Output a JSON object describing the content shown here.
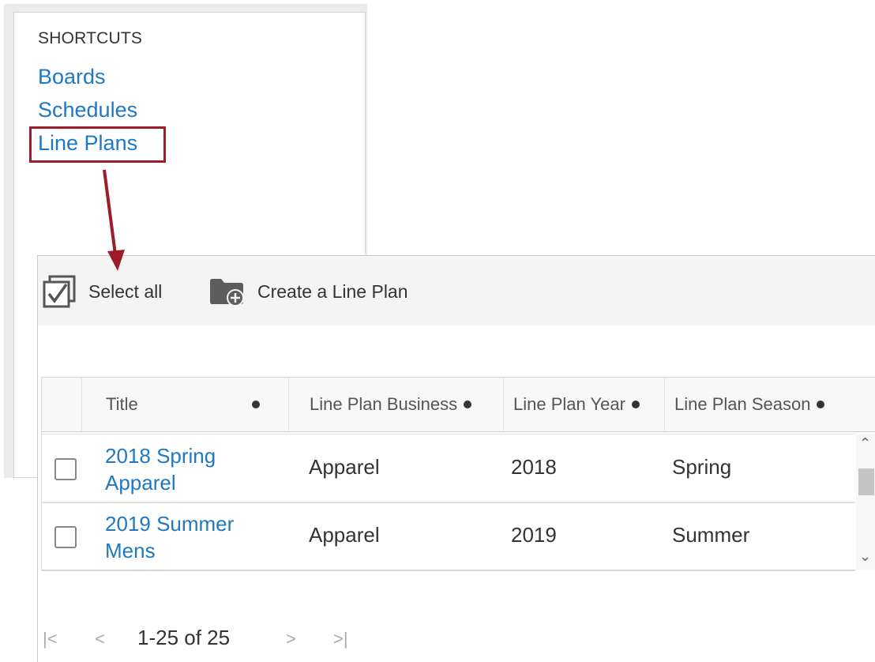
{
  "shortcuts": {
    "heading": "SHORTCUTS",
    "links": [
      "Boards",
      "Schedules",
      "Line Plans"
    ],
    "highlight_color": "#9d1c28"
  },
  "toolbar": {
    "select_all": "Select all",
    "create": "Create a Line Plan"
  },
  "grid": {
    "columns": [
      "Title",
      "Line Plan Business",
      "Line Plan Year",
      "Line Plan Season"
    ],
    "rows": [
      {
        "title": "2018 Spring Apparel",
        "business": "Apparel",
        "year": "2018",
        "season": "Spring"
      },
      {
        "title": "2019 Summer Mens",
        "business": "Apparel",
        "year": "2019",
        "season": "Summer"
      }
    ]
  },
  "pager": {
    "range": "1-25 of 25",
    "first_icon": "first-page-icon",
    "prev_icon": "prev-page-icon",
    "next_icon": "next-page-icon",
    "last_icon": "last-page-icon"
  },
  "colors": {
    "link": "#1f78c1",
    "annotation": "#9d1c28"
  }
}
